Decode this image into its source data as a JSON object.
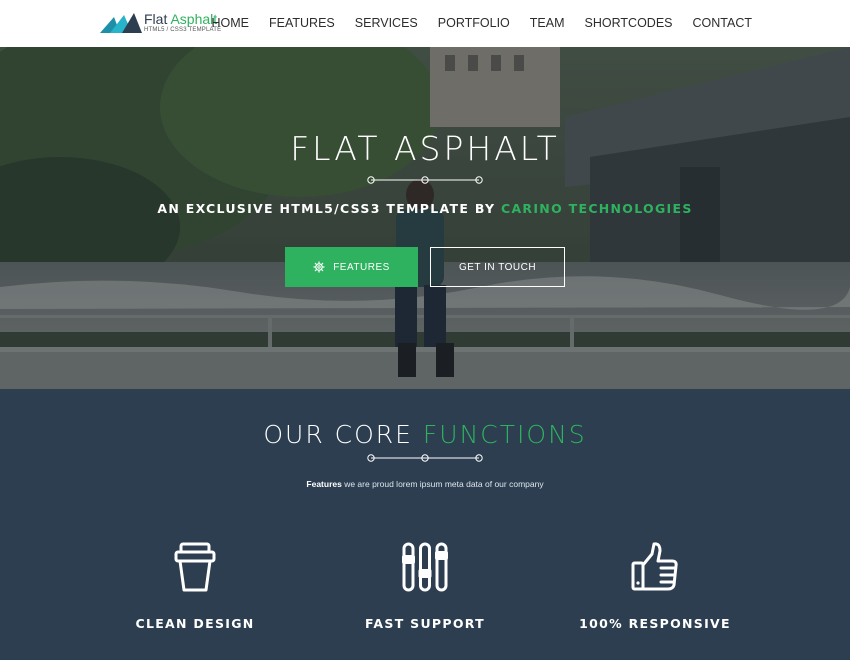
{
  "header": {
    "logo_main": "Flat",
    "logo_accent": "Asphalt",
    "logo_sub": "HTML5 / CSS3 TEMPLATE",
    "nav": [
      "HOME",
      "FEATURES",
      "SERVICES",
      "PORTFOLIO",
      "TEAM",
      "SHORTCODES",
      "CONTACT"
    ]
  },
  "hero": {
    "title": "FLAT ASPHALT",
    "subtitle_prefix": "AN EXCLUSIVE HTML5/CSS3 TEMPLATE BY ",
    "subtitle_accent": "CARINO TECHNOLOGIES",
    "btn_features": "FEATURES",
    "btn_contact": "GET IN TOUCH"
  },
  "functions": {
    "title_prefix": "OUR CORE ",
    "title_accent": "FUNCTIONS",
    "desc_bold": "Features",
    "desc_rest": " we are proud lorem ipsum meta data of our company",
    "items": [
      {
        "label": "CLEAN DESIGN",
        "icon": "cup-icon"
      },
      {
        "label": "FAST SUPPORT",
        "icon": "sliders-icon"
      },
      {
        "label": "100% RESPONSIVE",
        "icon": "thumbs-up-icon"
      }
    ]
  },
  "colors": {
    "accent": "#2fb25f",
    "dark_section": "#2c3e50",
    "header_bg": "#ffffff"
  }
}
